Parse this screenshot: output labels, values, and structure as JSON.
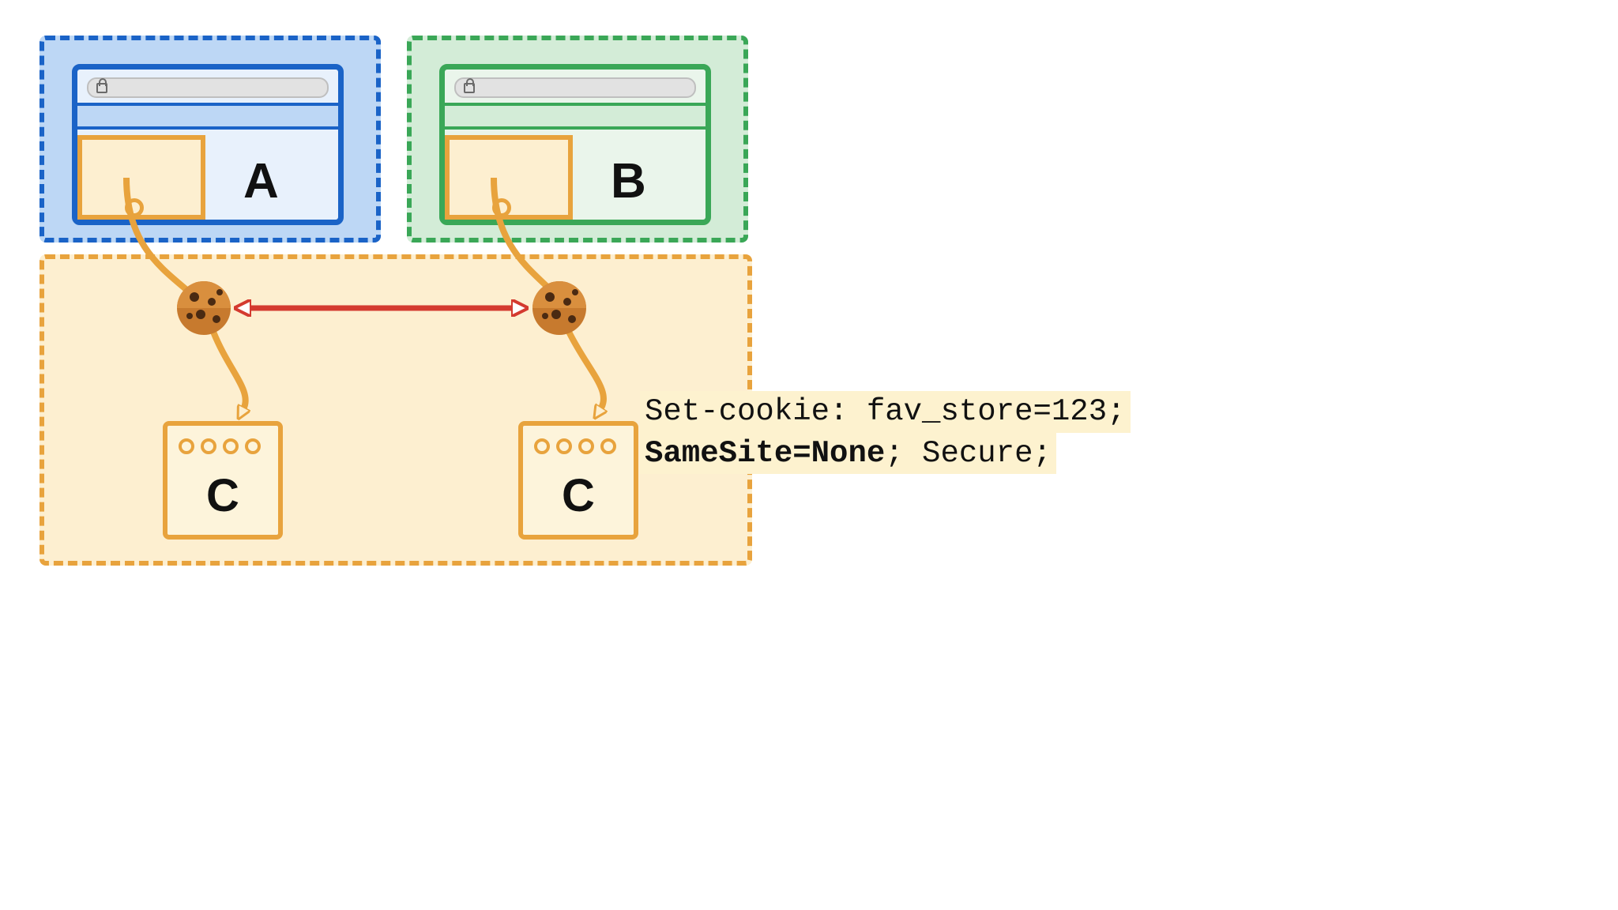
{
  "sites": {
    "a": "A",
    "b": "B",
    "c_left": "C",
    "c_right": "C"
  },
  "cookie_header": {
    "line1_prefix": "Set-cookie: fav_store=123;",
    "line2_bold": "SameSite=None",
    "line2_rest": "; Secure;"
  },
  "colors": {
    "siteA": "#1a63c7",
    "siteB": "#3aa757",
    "siteC_border": "#e8a33d",
    "siteC_fill": "#fdefd0",
    "arrow_red": "#d43a2f"
  },
  "diagram": {
    "description": "Two top-level sites A and B each embed an iframe; both iframes share cookies with third-party site C via Set-Cookie with SameSite=None; Secure.",
    "edges": [
      {
        "from": "iframe_in_A",
        "via": "cookie_left",
        "to": "site_C_left"
      },
      {
        "from": "iframe_in_B",
        "via": "cookie_right",
        "to": "site_C_right"
      },
      {
        "from": "cookie_left",
        "to": "cookie_right",
        "bidirectional": true
      }
    ]
  }
}
